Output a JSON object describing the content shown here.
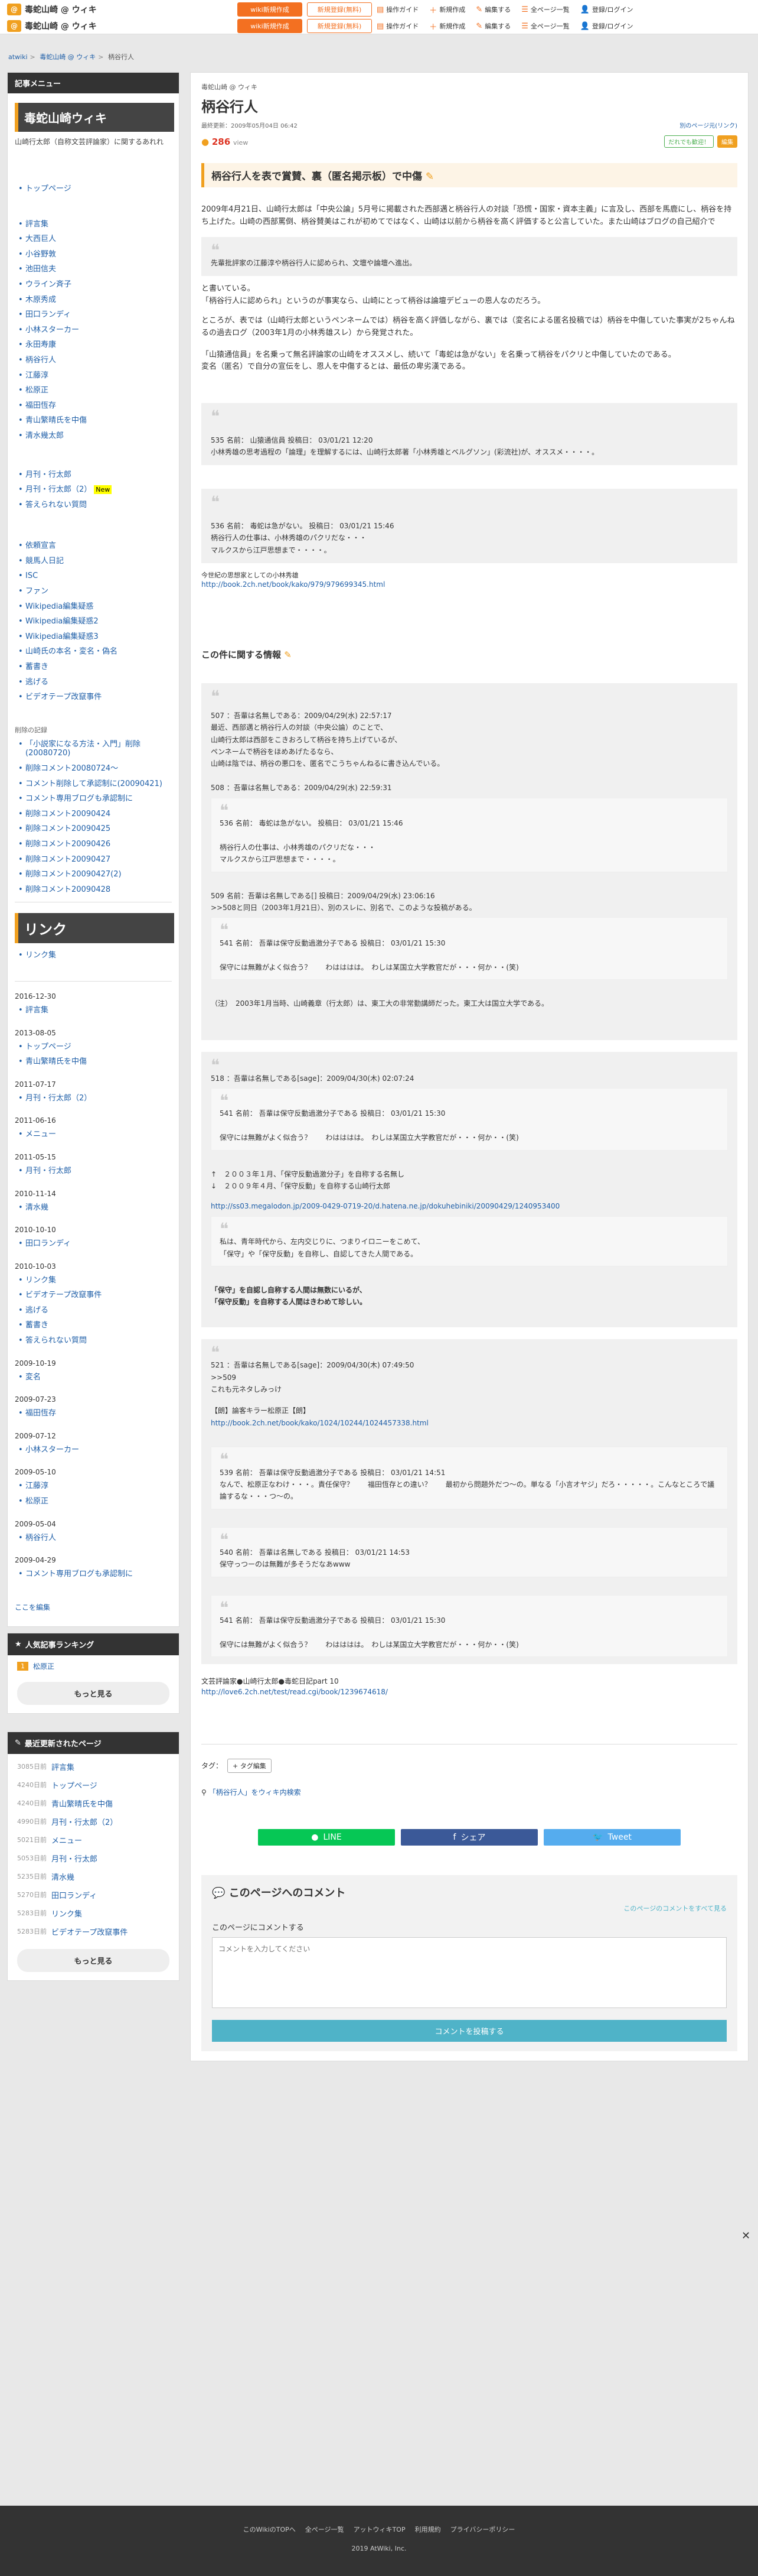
{
  "topbar": {
    "site_name": "毒蛇山崎 @ ウィキ",
    "logo_letter": "@",
    "btn_wiki_new": "wiki新規作成",
    "btn_login": "新規登録(無料)",
    "links": [
      "操作ガイド",
      "新規作成",
      "編集する",
      "全ページ一覧",
      "登録/ログイン"
    ],
    "link_icons": [
      "guide-icon",
      "plus-icon",
      "edit-icon",
      "list-icon",
      "user-icon"
    ]
  },
  "breadcrumb": [
    "atwiki",
    "毒蛇山崎 @ ウィキ",
    "柄谷行人"
  ],
  "sidebar": {
    "menu_head": "記事メニュー",
    "wiki_title": "毒蛇山崎ウィキ",
    "wiki_desc": "山崎行太郎（自称文芸評論家）に関するあれれ",
    "group1": [
      "トップページ"
    ],
    "group2": [
      "評言集",
      "大西巨人",
      "小谷野敦",
      "池田信夫",
      "ウライン斉子",
      "木原秀成",
      "田口ランディ",
      "小林スターカー",
      "永田寿康",
      "柄谷行人",
      "江藤淳",
      "松原正",
      "福田恆存",
      "青山繁晴氏を中傷",
      "清水幾太郎"
    ],
    "group3": [
      "月刊・行太郎",
      "月刊・行太郎（2）",
      "答えられない質問"
    ],
    "new_label": "New",
    "group4": [
      "依頼宣言",
      "競馬人日記",
      "ISC",
      "ファン",
      "Wikipedia編集疑惑",
      "Wikipedia編集疑惑2",
      "Wikipedia編集疑惑3",
      "山崎氏の本名・変名・偽名",
      "蓄書き",
      "逃げる",
      "ビデオテープ改竄事件"
    ],
    "deleted_head": "削除の記録",
    "group5": [
      "「小説家になる方法・入門」削除(20080720)",
      "削除コメント20080724〜",
      "コメント削除して承認制に(20090421)",
      "コメント専用ブログも承認制に",
      "削除コメント20090424",
      "削除コメント20090425",
      "削除コメント20090426",
      "削除コメント20090427",
      "削除コメント20090427(2)",
      "削除コメント20090428"
    ],
    "link_title": "リンク",
    "link_items": [
      "リンク集"
    ],
    "updates": [
      {
        "date": "2016-12-30",
        "items": [
          "評言集"
        ]
      },
      {
        "date": "2013-08-05",
        "items": [
          "トップページ",
          "青山繁晴氏を中傷"
        ]
      },
      {
        "date": "2011-07-17",
        "items": [
          "月刊・行太郎（2）"
        ]
      },
      {
        "date": "2011-06-16",
        "items": [
          "メニュー"
        ]
      },
      {
        "date": "2011-05-15",
        "items": [
          "月刊・行太郎"
        ]
      },
      {
        "date": "2010-11-14",
        "items": [
          "清水幾"
        ]
      },
      {
        "date": "2010-10-10",
        "items": [
          "田口ランディ"
        ]
      },
      {
        "date": "2010-10-03",
        "items": [
          "リンク集",
          "ビデオテープ改竄事件",
          "逃げる",
          "蓄書き",
          "答えられない質問"
        ]
      },
      {
        "date": "2009-10-19",
        "items": [
          "変名"
        ]
      },
      {
        "date": "2009-07-23",
        "items": [
          "福田恆存"
        ]
      },
      {
        "date": "2009-07-12",
        "items": [
          "小林スターカー"
        ]
      },
      {
        "date": "2009-05-10",
        "items": [
          "江藤淳",
          "松原正"
        ]
      },
      {
        "date": "2009-05-04",
        "items": [
          "柄谷行人"
        ]
      },
      {
        "date": "2009-04-29",
        "items": [
          "コメント専用ブログも承認制に"
        ]
      }
    ],
    "edit_here": "ここを編集",
    "ranking_head": "人気記事ランキング",
    "ranking": [
      {
        "num": "1",
        "title": "松原正"
      }
    ],
    "more": "もっと見る",
    "recent_head": "最近更新されたページ",
    "recent": [
      {
        "d": "3085日前",
        "t": "評言集"
      },
      {
        "d": "4240日前",
        "t": "トップページ"
      },
      {
        "d": "4240日前",
        "t": "青山繁晴氏を中傷"
      },
      {
        "d": "4990日前",
        "t": "月刊・行太郎（2）"
      },
      {
        "d": "5021日前",
        "t": "メニュー"
      },
      {
        "d": "5053日前",
        "t": "月刊・行太郎"
      },
      {
        "d": "5235日前",
        "t": "清水幾"
      },
      {
        "d": "5270日前",
        "t": "田口ランディ"
      },
      {
        "d": "5283日前",
        "t": "リンク集"
      },
      {
        "d": "5283日前",
        "t": "ビデオテープ改竄事件"
      }
    ]
  },
  "main": {
    "site": "毒蛇山崎 @ ウィキ",
    "title": "柄谷行人",
    "updated": "最終更新：2009年05月04日 06:42",
    "site_link": "別のページ元(リンク)",
    "views": "286",
    "views_unit": "view",
    "btn_help": "だれでも歓迎！",
    "btn_edit": "編集",
    "h2_1": "柄谷行人を表で賞賛、裏（匿名掲示板）で中傷",
    "p1": "2009年4月21日、山崎行太郎は「中央公論」5月号に掲載された西部邁と柄谷行人の対談「恐慌・国家・資本主義」に言及し、西部を馬鹿にし、柄谷を持ち上げた。山崎の西部罵倒、柄谷賛美はこれが初めてではなく、山崎は以前から柄谷を高く評価すると公言していた。また山崎はブログの自己紹介で",
    "q1": "先輩批評家の江藤淳や柄谷行人に認められ、文壇や論壇へ進出。",
    "p2": "と書いている。\n「柄谷行人に認められ」というのが事実なら、山崎にとって柄谷は論壇デビューの恩人なのだろう。",
    "p3": "ところが、表では（山崎行太郎というペンネームでは）柄谷を高く評価しながら、裏では（変名による匿名投稿では）柄谷を中傷していた事実が2ちゃんねるの過去ログ（2003年1月の小林秀雄スレ）から発覚された。",
    "p4": "「山猿通信員」を名乗って無名評論家の山崎をオススメし、続いて「毒蛇は急がない」を名乗って柄谷をパクリと中傷していたのである。\n変名（匿名）で自分の宣伝をし、恩人を中傷するとは、最低の卑劣漢である。",
    "q2": "535 名前： 山猿通信員 投稿日： 03/01/21 12:20\n小林秀雄の思考過程の「論理」を理解するには、山崎行太郎著「小林秀雄とベルグソン」(彩流社)が、オススメ・・・・。",
    "q3": "536 名前： 毒蛇は急がない。 投稿日： 03/01/21 15:46\n柄谷行人の仕事は、小林秀雄のパクリだな・・・\nマルクスから江戸思想まで・・・・。",
    "p5": "今世紀の思想家としての小林秀雄",
    "link5": "http://book.2ch.net/book/kako/979/979699345.html",
    "h3": "この件に関する情報",
    "q4": "507 ：吾輩は名無しである：2009/04/29(水) 22:57:17\n最近、西部邁と柄谷行人の対談（中央公論）のことで、\n山崎行太郎は西部をこきおろして柄谷を持ち上げているが、\nペンネームで柄谷をほめあげたるなら、\n山崎は陰では、柄谷の悪口を、匿名でこうちゃんねるに書き込んでいる。\n\n508 ：吾輩は名無しである：2009/04/29(水) 22:59:31",
    "q4_inner": "536 名前： 毒蛇は急がない。 投稿日： 03/01/21 15:46\n\n柄谷行人の仕事は、小林秀雄のパクリだな・・・\nマルクスから江戸思想まで・・・・。",
    "q4_b": "509 名前：吾輩は名無しである[] 投稿日：2009/04/29(水) 23:06:16\n>>508と同日（2003年1月21日）、別のスレに、別名で、このような投稿がある。",
    "q4_inner2": "541 名前： 吾輩は保守反動過激分子である 投稿日： 03/01/21 15:30\n\n保守には無難がよく似合う？　　わはははは。　わしは某国立大学教官だが・・・何か・・(笑)",
    "q4_c": "（注）　2003年1月当時、山崎義章（行太郎）は、東工大の非常勤講師だった。東工大は国立大学である。",
    "q5": "518 ：吾輩は名無しである[sage]：2009/04/30(木) 02:07:24",
    "q5_inner": "541 名前： 吾輩は保守反動過激分子である 投稿日： 03/01/21 15:30\n\n保守には無難がよく似合う？　　わはははは。　わしは某国立大学教官だが・・・何か・・(笑)",
    "q5_b": "↑　２００３年１月、「保守反動過激分子」を自称する名無し\n↓　２００９年４月、「保守反動」を自称する山崎行太郎",
    "q5_link": "http://ss03.megalodon.jp/2009-0429-0719-20/d.hatena.ne.jp/dokuhebiniki/20090429/1240953400",
    "q5_inner2": "私は、青年時代から、左内交じりに、つまりイロニーをこめて、\n「保守」や「保守反動」を自称し、自認してきた人間である。",
    "q5_c": "「保守」を自認し自称する人間は無数にいるが、\n「保守反動」を自称する人間はきわめて珍しい。",
    "q6": "521 ：吾輩は名無しである[sage]：2009/04/30(木) 07:49:50\n>>509\nこれも元ネタしみっけ",
    "q6_b": "【朗】論客キラー松原正【朗】",
    "q6_link": "http://book.2ch.net/book/kako/1024/10244/1024457338.html",
    "q6_inner": "539 名前： 吾輩は保守反動過激分子である 投稿日： 03/01/21 14:51\nなんで、松原正なわけ・・・。責任保守？　　福田恆存との違い？　　最初から問題外だつ〜の。単なる「小言オヤジ」だろ・・・・・。こんなところで議論するな・・・つ〜の。",
    "q6_inner2": "540 名前： 吾輩は名無しである 投稿日： 03/01/21 14:53\n保守っつーのは無難が多そうだなあwww",
    "q6_inner3": "541 名前： 吾輩は保守反動過激分子である 投稿日： 03/01/21 15:30\n\n保守には無難がよく似合う？　　わはははは。　わしは某国立大学教官だが・・・何か・・(笑)",
    "p_end": "文芸評論家●山崎行太郎●毒蛇日記part 10",
    "link_end": "http://love6.2ch.net/test/read.cgi/book/1239674618/",
    "tag_label": "タグ：",
    "tag_btn": "+ タグ編集",
    "search": "「柄谷行人」をウィキ内検索",
    "share_line": "LINE",
    "share_fb": "シェア",
    "share_tw": "Tweet"
  },
  "comment": {
    "head": "このページへのコメント",
    "see_all": "このページのコメントをすべて見る",
    "label": "このページにコメントする",
    "placeholder": "コメントを入力してください",
    "post": "コメントを投稿する"
  },
  "footer": {
    "links": [
      "このWikiのTOPへ",
      "全ページ一覧",
      "アットウィキTOP",
      "利用規約",
      "プライバシーポリシー"
    ],
    "copy": "2019 AtWiki, Inc."
  }
}
